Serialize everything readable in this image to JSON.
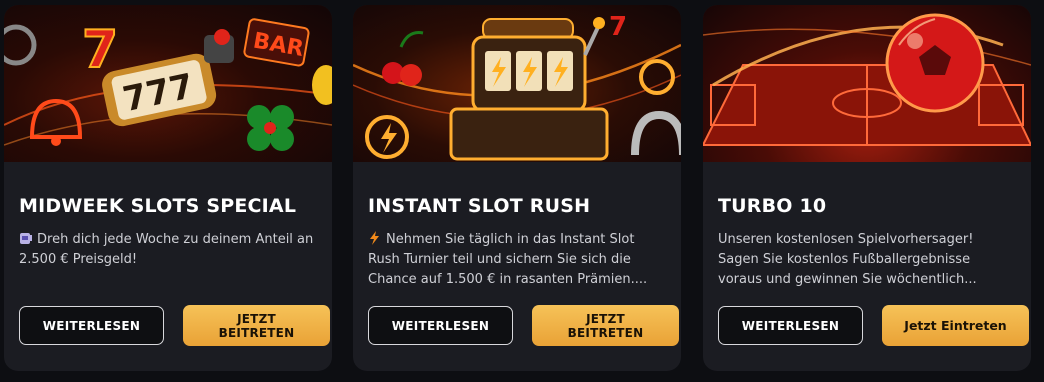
{
  "cards": [
    {
      "title": "MIDWEEK SLOTS SPECIAL",
      "description": "Dreh dich jede Woche zu deinem Anteil an 2.500 € Preisgeld!",
      "icon": "slot-machine-emoji-icon",
      "read_more_label": "WEITERLESEN",
      "join_line1": "JETZT",
      "join_line2": "BEITRETEN"
    },
    {
      "title": "INSTANT SLOT RUSH",
      "description": "Nehmen Sie täglich in das Instant Slot Rush Turnier teil und sichern Sie sich die Chance auf 1.500 € in rasanten Prämien....",
      "icon": "lightning-emoji-icon",
      "read_more_label": "WEITERLESEN",
      "join_line1": "JETZT",
      "join_line2": "BEITRETEN"
    },
    {
      "title": "TURBO 10",
      "description": "Unseren kostenlosen Spielvorhersager! Sagen Sie kostenlos Fußballergebnisse voraus und gewinnen Sie wöchentlich...",
      "read_more_label": "WEITERLESEN",
      "join_label": "Jetzt Eintreten"
    }
  ],
  "colors": {
    "card_bg": "#1b1c22",
    "page_bg": "#0d0e12",
    "gold_button": "#f0b043",
    "accent_red": "#e23a1e"
  }
}
